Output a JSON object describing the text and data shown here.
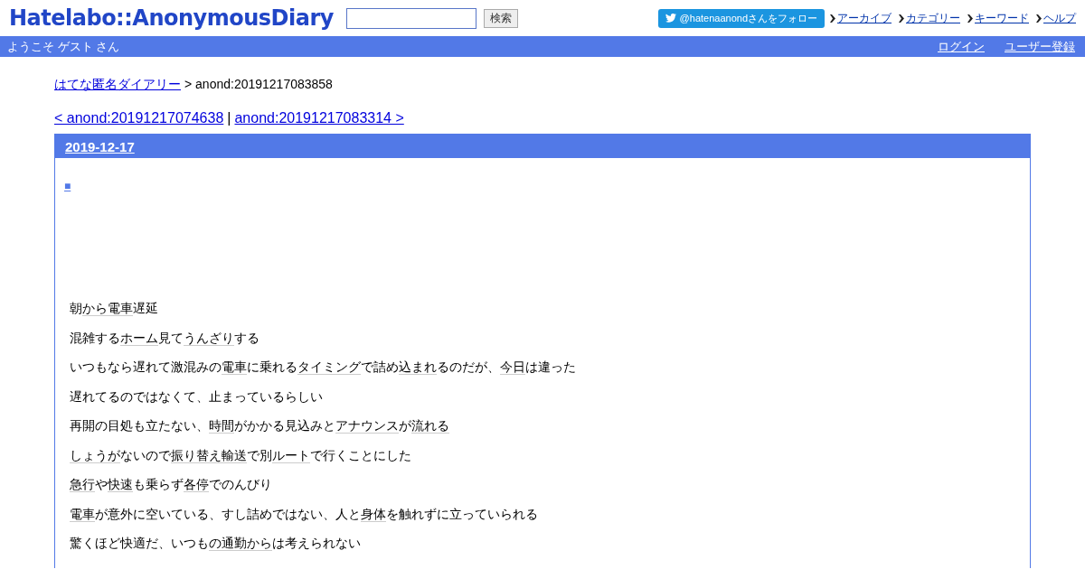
{
  "header": {
    "logo": "Hatelabo::AnonymousDiary",
    "search": {
      "button": "検索"
    },
    "follow_button": "@hatenaanondさんをフォロー",
    "nav": [
      "アーカイブ",
      "カテゴリー",
      "キーワード",
      "ヘルプ"
    ]
  },
  "welcome_bar": {
    "greeting": "ようこそ ゲスト さん",
    "links": [
      "ログイン",
      "ユーザー登録"
    ]
  },
  "breadcrumb": {
    "link": "はてな匿名ダイアリー",
    "current": "> anond:20191217083858"
  },
  "pager": {
    "prev": "< anond:20191217074638",
    "separator": "|",
    "next": "anond:20191217083314 >"
  },
  "day": {
    "date": "2019-12-17",
    "anchor": "■",
    "paragraphs": [
      [
        {
          "kind": "text",
          "text": "朝"
        },
        {
          "kind": "keyword",
          "text": "から"
        },
        {
          "kind": "keyword",
          "text": "電車"
        },
        {
          "kind": "text",
          "text": "遅延"
        }
      ],
      [
        {
          "kind": "text",
          "text": "混雑する"
        },
        {
          "kind": "keyword",
          "text": "ホーム"
        },
        {
          "kind": "text",
          "text": "見て"
        },
        {
          "kind": "keyword",
          "text": "うんざり"
        },
        {
          "kind": "text",
          "text": "する"
        }
      ],
      [
        {
          "kind": "text",
          "text": "いつもなら遅れて激混みの"
        },
        {
          "kind": "keyword",
          "text": "電車"
        },
        {
          "kind": "text",
          "text": "に乗れる"
        },
        {
          "kind": "keyword",
          "text": "タイミング"
        },
        {
          "kind": "text",
          "text": "で詰め"
        },
        {
          "kind": "keyword",
          "text": "込まれ"
        },
        {
          "kind": "text",
          "text": "るのだが、"
        },
        {
          "kind": "keyword",
          "text": "今日"
        },
        {
          "kind": "text",
          "text": "は違った"
        }
      ],
      [
        {
          "kind": "text",
          "text": "遅れてるのではなくて、止まっているらしい"
        }
      ],
      [
        {
          "kind": "text",
          "text": "再開の目処も立たない、"
        },
        {
          "kind": "keyword",
          "text": "時間"
        },
        {
          "kind": "text",
          "text": "がかかる見込みと"
        },
        {
          "kind": "keyword",
          "text": "アナウンス"
        },
        {
          "kind": "text",
          "text": "が"
        },
        {
          "kind": "keyword",
          "text": "流れる"
        }
      ],
      [
        {
          "kind": "keyword",
          "text": "しょうが"
        },
        {
          "kind": "text",
          "text": "ないので"
        },
        {
          "kind": "keyword",
          "text": "振り替え輸送"
        },
        {
          "kind": "text",
          "text": "で別"
        },
        {
          "kind": "keyword",
          "text": "ルート"
        },
        {
          "kind": "text",
          "text": "で行くことにした"
        }
      ],
      [
        {
          "kind": "keyword",
          "text": "急行"
        },
        {
          "kind": "text",
          "text": "や"
        },
        {
          "kind": "keyword",
          "text": "快速"
        },
        {
          "kind": "text",
          "text": "も乗らず"
        },
        {
          "kind": "keyword",
          "text": "各停"
        },
        {
          "kind": "text",
          "text": "でのんびり"
        }
      ],
      [
        {
          "kind": "keyword",
          "text": "電車"
        },
        {
          "kind": "text",
          "text": "が意外に空いている、すし詰めではない、人と"
        },
        {
          "kind": "keyword",
          "text": "身体"
        },
        {
          "kind": "text",
          "text": "を触れずに立っていられる"
        }
      ],
      [
        {
          "kind": "text",
          "text": "驚くほど快適だ、いつも"
        },
        {
          "kind": "keyword",
          "text": "の通勤から"
        },
        {
          "kind": "text",
          "text": "は考えられない"
        }
      ]
    ]
  }
}
